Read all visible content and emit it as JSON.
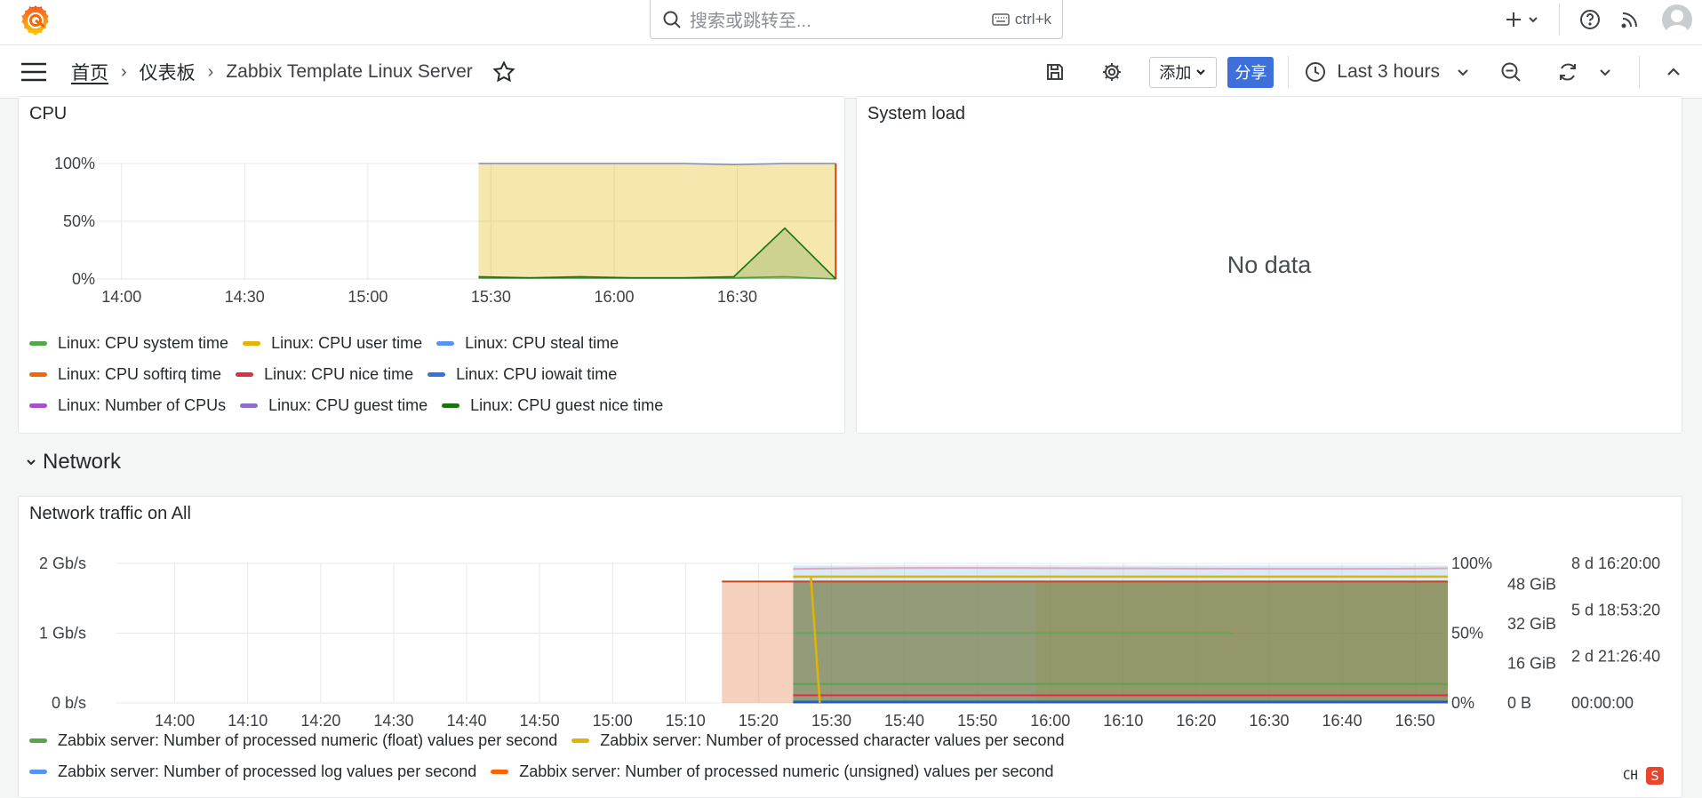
{
  "colors": {
    "accent": "#3d71d9",
    "grafana_orange": "#f46800",
    "grafana_yellow": "#fbca0a"
  },
  "search": {
    "placeholder": "搜索或跳转至...",
    "shortcut": "ctrl+k"
  },
  "breadcrumb": {
    "home": "首页",
    "dashboards": "仪表板",
    "current": "Zabbix Template Linux Server"
  },
  "toolbar": {
    "add_label": "添加",
    "share_label": "分享",
    "time_range": "Last 3 hours"
  },
  "cpu_panel": {
    "title": "CPU",
    "legend": [
      {
        "label": "Linux: CPU system time",
        "color": "#56a64b"
      },
      {
        "label": "Linux: CPU user time",
        "color": "#e0b400"
      },
      {
        "label": "Linux: CPU steal time",
        "color": "#5794f2"
      },
      {
        "label": "Linux: CPU softirq time",
        "color": "#fa6400"
      },
      {
        "label": "Linux: CPU nice time",
        "color": "#e02f44"
      },
      {
        "label": "Linux: CPU iowait time",
        "color": "#3274d9"
      },
      {
        "label": "Linux: Number of CPUs",
        "color": "#a352cc"
      },
      {
        "label": "Linux: CPU guest time",
        "color": "#8f6ec8"
      },
      {
        "label": "Linux: CPU guest nice time",
        "color": "#19730e"
      }
    ]
  },
  "system_load_panel": {
    "title": "System load",
    "no_data": "No data"
  },
  "network_row": {
    "title": "Network"
  },
  "network_panel": {
    "title": "Network traffic on All",
    "legend": [
      {
        "label": "Zabbix server: Number of processed numeric (float) values per second",
        "color": "#56a64b"
      },
      {
        "label": "Zabbix server: Number of processed character values per second",
        "color": "#e0b400"
      },
      {
        "label": "Zabbix server: Number of processed log values per second",
        "color": "#5794f2"
      },
      {
        "label": "Zabbix server: Number of processed numeric (unsigned) values per second",
        "color": "#fa6400"
      }
    ]
  },
  "chart_data": [
    {
      "type": "area",
      "title": "CPU",
      "categories": [
        "14:00",
        "14:30",
        "15:00",
        "15:30",
        "16:00",
        "16:30"
      ],
      "y_ticks": [
        "0%",
        "50%",
        "100%"
      ],
      "ylim": [
        0,
        100
      ],
      "data_start": "15:27",
      "data_end": "16:54",
      "series": [
        {
          "name": "Linux: CPU user time",
          "color": "#e0b400",
          "values": [
            100,
            100,
            100,
            100,
            100,
            99,
            100,
            100
          ]
        },
        {
          "name": "Linux: CPU system time",
          "color": "#56a64b",
          "values": [
            1,
            1,
            1,
            1,
            1,
            1,
            2,
            0
          ]
        },
        {
          "name": "Linux: CPU guest nice time",
          "color": "#19730e",
          "values": [
            2,
            1,
            2,
            1,
            1,
            2,
            44,
            0
          ]
        }
      ],
      "grid": true,
      "legend_position": "bottom"
    },
    {
      "type": "line",
      "title": "Network traffic on All",
      "categories": [
        "14:00",
        "14:10",
        "14:20",
        "14:30",
        "14:40",
        "14:50",
        "15:00",
        "15:10",
        "15:20",
        "15:30",
        "15:40",
        "15:50",
        "16:00",
        "16:10",
        "16:20",
        "16:30",
        "16:40",
        "16:50"
      ],
      "y_left_ticks": [
        "0 b/s",
        "1 Gb/s",
        "2 Gb/s"
      ],
      "y_right_percent_ticks": [
        "0%",
        "50%",
        "100%"
      ],
      "y_right_bytes_ticks": [
        "0 B",
        "16 GiB",
        "32 GiB",
        "48 GiB"
      ],
      "y_right_duration_ticks": [
        "00:00:00",
        "2 d 21:26:40",
        "5 d 18:53:20",
        "8 d 16:20:00"
      ],
      "grid": true,
      "legend_position": "bottom"
    }
  ]
}
